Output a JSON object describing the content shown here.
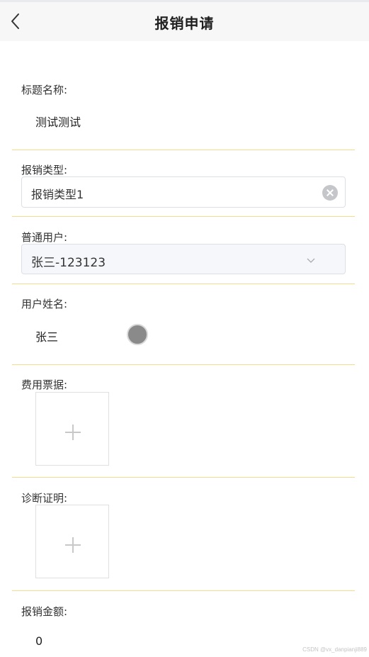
{
  "header": {
    "title": "报销申请",
    "back_icon": "chevron-left-icon"
  },
  "form": {
    "title_name": {
      "label": "标题名称:",
      "value": "测试测试"
    },
    "expense_type": {
      "label": "报销类型:",
      "value": "报销类型1"
    },
    "regular_user": {
      "label": "普通用户:",
      "value": "张三-123123"
    },
    "user_name": {
      "label": "用户姓名:",
      "value": "张三"
    },
    "expense_receipt": {
      "label": "费用票据:"
    },
    "diagnosis_certificate": {
      "label": "诊断证明:"
    },
    "reimbursement_amount": {
      "label": "报销金额:",
      "value": "0"
    }
  },
  "watermark": "CSDN @vx_danpianji889",
  "colors": {
    "divider": "#f5dc8c",
    "status_dot": "#8a8a8a"
  }
}
